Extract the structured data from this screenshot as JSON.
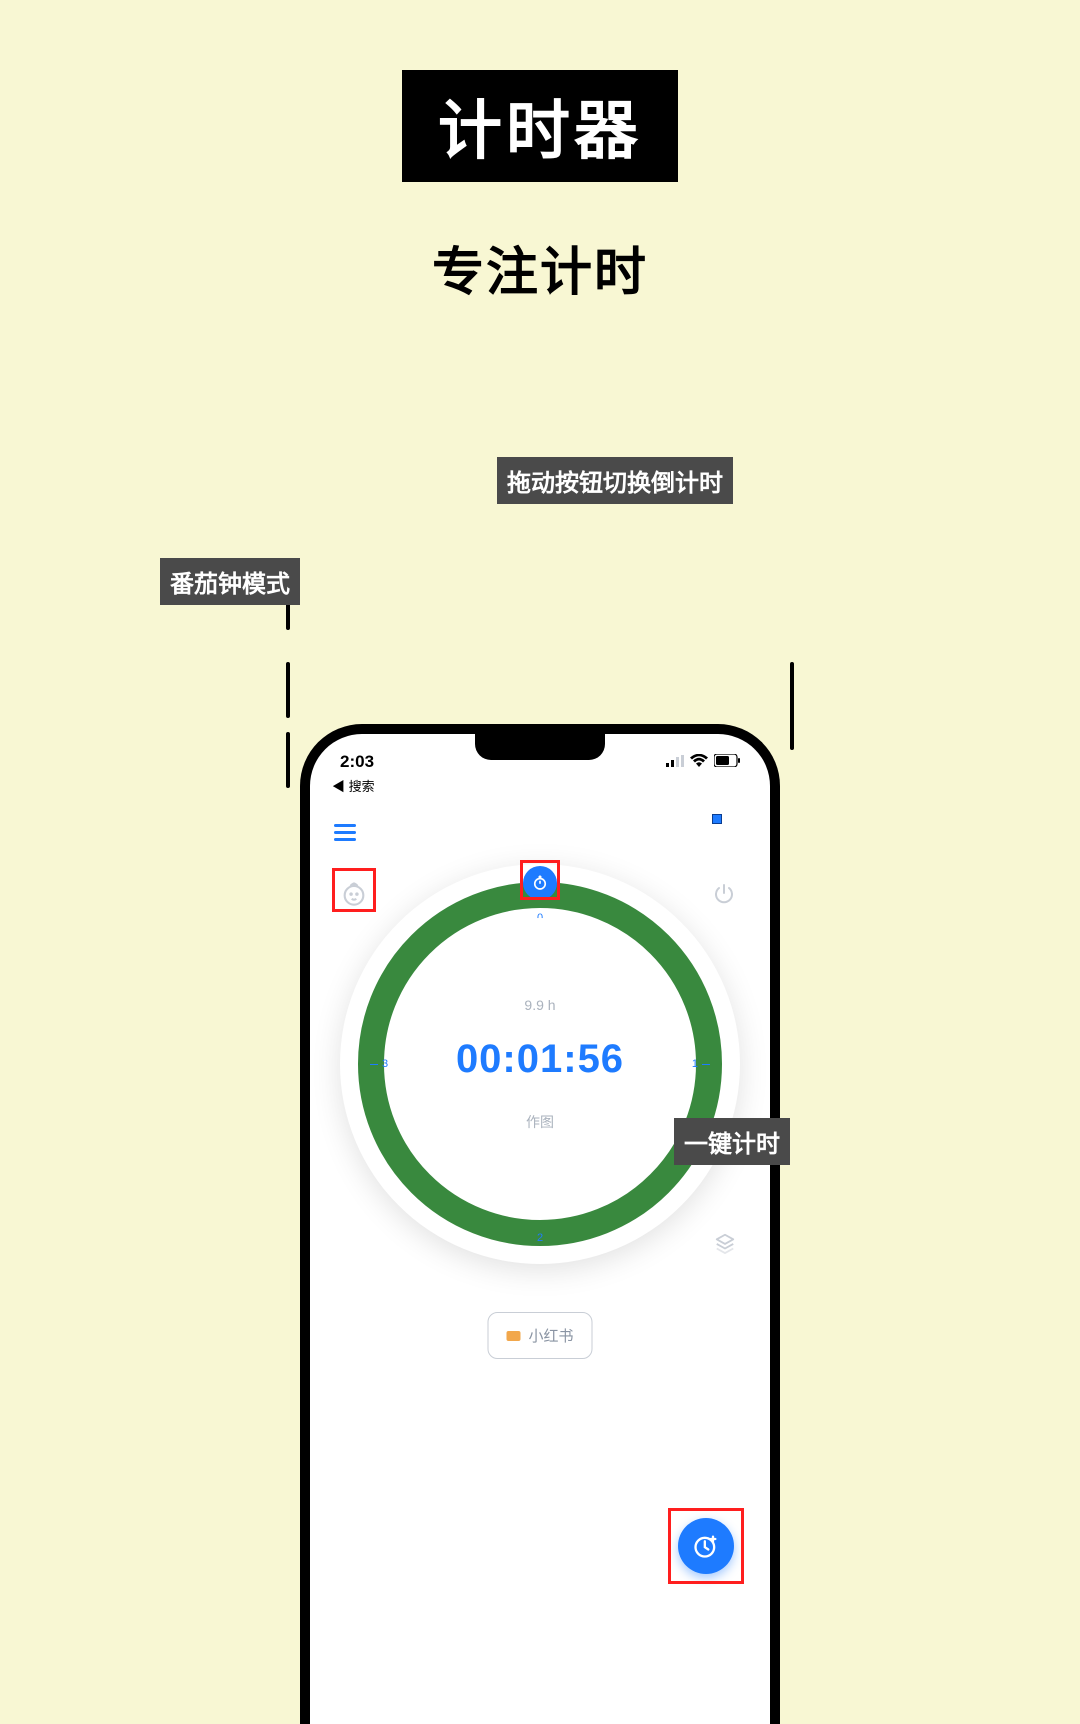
{
  "header": {
    "badge": "计时器",
    "subtitle": "专注计时"
  },
  "callouts": {
    "pomodoro": "番茄钟模式",
    "drag": "拖动按钮切换倒计时",
    "fab": "一键计时"
  },
  "status_bar": {
    "time": "2:03",
    "back_label": "◀ 搜索"
  },
  "timer": {
    "hours_label": "9.9 h",
    "value": "00:01:56",
    "center_label": "作图",
    "markers": {
      "m0": "0",
      "m1": "1",
      "m2": "2",
      "m3": "3"
    }
  },
  "tag": {
    "label": "小红书"
  },
  "colors": {
    "accent": "#1e7bff",
    "ring": "#39893e",
    "bg": "#f8f7d3",
    "highlight": "#ff1e1e"
  }
}
